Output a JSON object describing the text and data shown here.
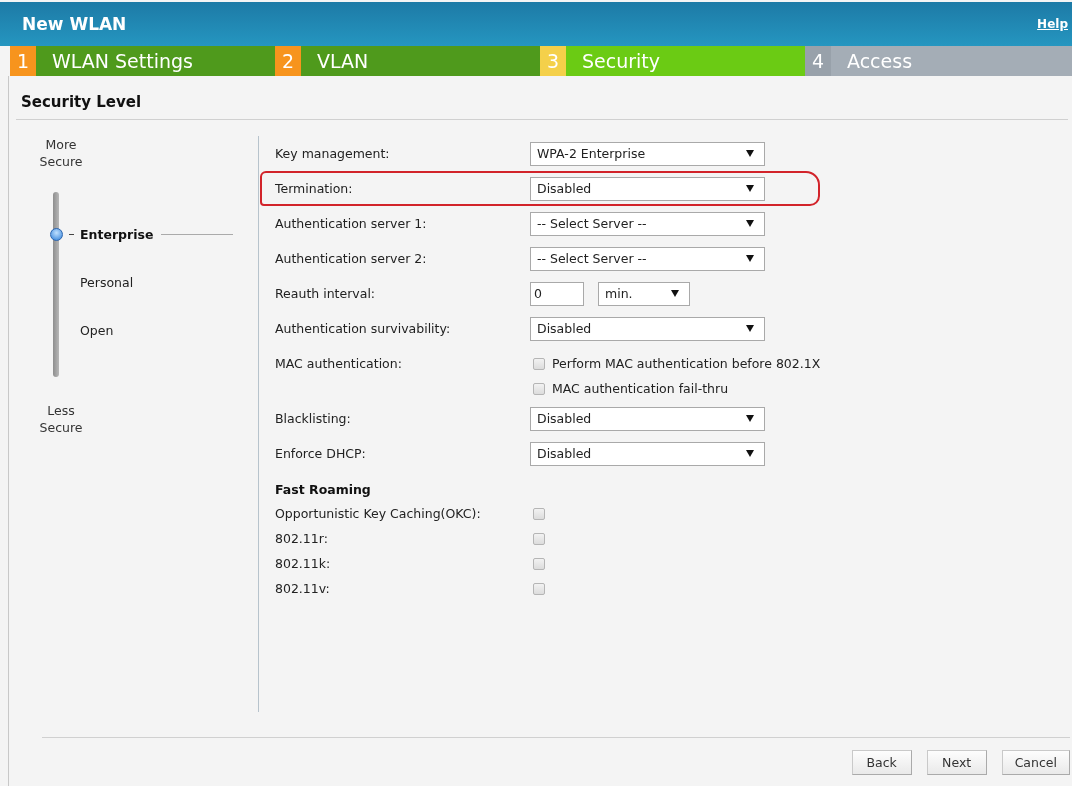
{
  "window": {
    "title": "New WLAN",
    "help_link": "Help"
  },
  "steps": [
    {
      "number": "1",
      "label": "WLAN Settings",
      "completed": true,
      "selected": false
    },
    {
      "number": "2",
      "label": "VLAN",
      "completed": true,
      "selected": false
    },
    {
      "number": "3",
      "label": "Security",
      "completed": false,
      "selected": true
    },
    {
      "number": "4",
      "label": "Access",
      "completed": false,
      "selected": false
    }
  ],
  "section_title": "Security Level",
  "security_slider": {
    "top_label": "More Secure",
    "bottom_label": "Less Secure",
    "levels": [
      {
        "label": "Enterprise",
        "selected": true
      },
      {
        "label": "Personal",
        "selected": false
      },
      {
        "label": "Open",
        "selected": false
      }
    ]
  },
  "form": {
    "rows": [
      {
        "kind": "select",
        "label": "Key management:",
        "value": "WPA-2 Enterprise",
        "highlighted": false
      },
      {
        "kind": "select",
        "label": "Termination:",
        "value": "Disabled",
        "highlighted": true
      },
      {
        "kind": "select",
        "label": "Authentication server 1:",
        "value": "-- Select Server --",
        "highlighted": false
      },
      {
        "kind": "select",
        "label": "Authentication server 2:",
        "value": "-- Select Server --",
        "highlighted": false
      },
      {
        "kind": "interval",
        "label": "Reauth interval:",
        "value": "0",
        "unit": "min.",
        "highlighted": false
      },
      {
        "kind": "select",
        "label": "Authentication survivability:",
        "value": "Disabled",
        "highlighted": false
      },
      {
        "kind": "checkboxes",
        "label": "MAC authentication:",
        "highlighted": false,
        "options": [
          {
            "label": "Perform MAC authentication before 802.1X",
            "checked": false
          },
          {
            "label": "MAC authentication fail-thru",
            "checked": false
          }
        ]
      },
      {
        "kind": "select",
        "label": "Blacklisting:",
        "value": "Disabled",
        "highlighted": false
      },
      {
        "kind": "select",
        "label": "Enforce DHCP:",
        "value": "Disabled",
        "highlighted": false
      }
    ],
    "fast_roaming": {
      "title": "Fast Roaming",
      "options": [
        {
          "label": "Opportunistic Key Caching(OKC):",
          "checked": false
        },
        {
          "label": "802.11r:",
          "checked": false
        },
        {
          "label": "802.11k:",
          "checked": false
        },
        {
          "label": "802.11v:",
          "checked": false
        }
      ]
    }
  },
  "buttons": [
    "Back",
    "Next",
    "Cancel"
  ]
}
